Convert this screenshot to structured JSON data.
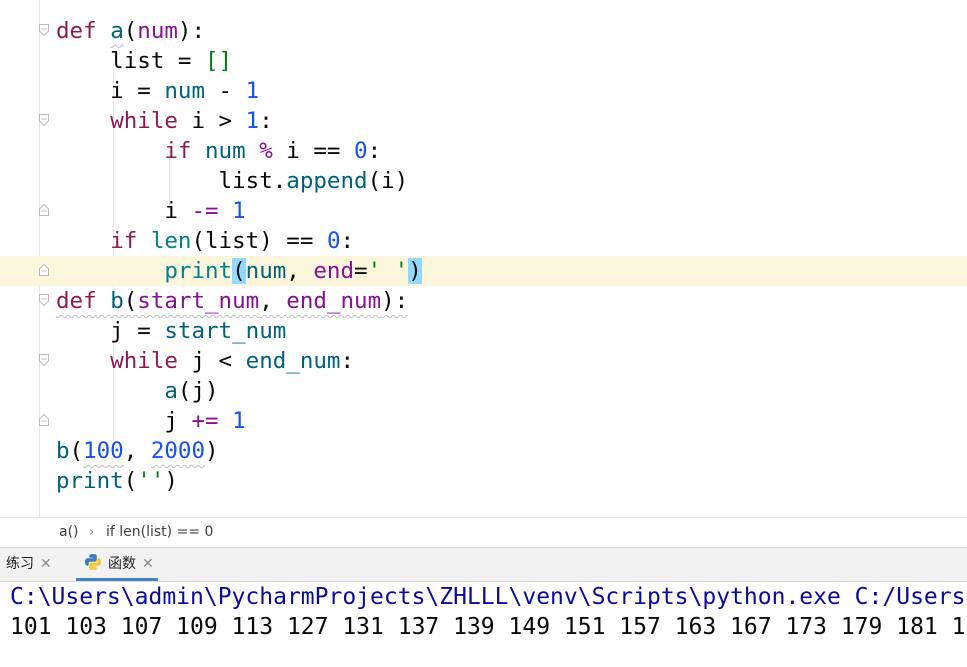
{
  "editor": {
    "lines": [
      {
        "code": "def a(num):"
      },
      {
        "code": "    list = []"
      },
      {
        "code": "    i = num - 1"
      },
      {
        "code": "    while i > 1:"
      },
      {
        "code": "        if num % i == 0:"
      },
      {
        "code": "            list.append(i)"
      },
      {
        "code": "        i -= 1"
      },
      {
        "code": "    if len(list) == 0:"
      },
      {
        "code": "        print(num, end=' ')"
      },
      {
        "code": "def b(start_num, end_num):"
      },
      {
        "code": "    j = start_num"
      },
      {
        "code": "    while j < end_num:"
      },
      {
        "code": "        a(j)"
      },
      {
        "code": "        j += 1"
      },
      {
        "code": "b(100, 2000)"
      },
      {
        "code": "print('')"
      }
    ],
    "current_line": 9
  },
  "breadcrumb": {
    "items": [
      "a()",
      "if len(list) == 0"
    ],
    "separator": "›"
  },
  "run_panel": {
    "tabs": [
      {
        "label": "练习",
        "active": false,
        "close": "✕"
      },
      {
        "label": "函数",
        "active": true,
        "close": "✕"
      }
    ]
  },
  "console": {
    "command": "C:\\Users\\admin\\PycharmProjects\\ZHLLL\\venv\\Scripts\\python.exe C:/Users",
    "output": "101 103 107 109 113 127 131 137 139 149 151 157 163 167 173 179 181 1"
  },
  "colors": {
    "keyword": "#0033b3",
    "def_keyword": "#8d1a54",
    "number": "#1750eb",
    "string": "#067d17",
    "parameter": "#871094",
    "current_line_bg": "#fbf6dc",
    "active_tab_underline": "#4083c9"
  }
}
